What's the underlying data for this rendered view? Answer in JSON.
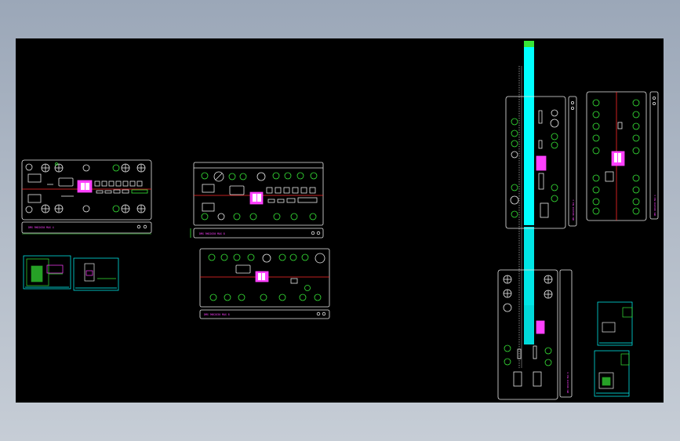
{
  "viewport": {
    "background": "#9ba7b8"
  },
  "drawing_area": {
    "background": "#000000"
  },
  "colors": {
    "outline": "#e8e8e8",
    "green": "#37e637",
    "red": "#ff2a2a",
    "magenta": "#ff40ff",
    "cyan": "#00ffff"
  },
  "panels": {
    "panel_1_label": "DMX 9KK2030 MAX 4",
    "panel_2_label": "DMX 9KK2030 MAX 8",
    "panel_3_label": "DMX 9KK2030 MAX 8",
    "panel_4_label": "DMX 9KK2030 MAX 4",
    "panel_5_label": "DMX 9KK2030 MAX 8",
    "panel_6_label": "DMX 9KK2030 MAX 4"
  }
}
